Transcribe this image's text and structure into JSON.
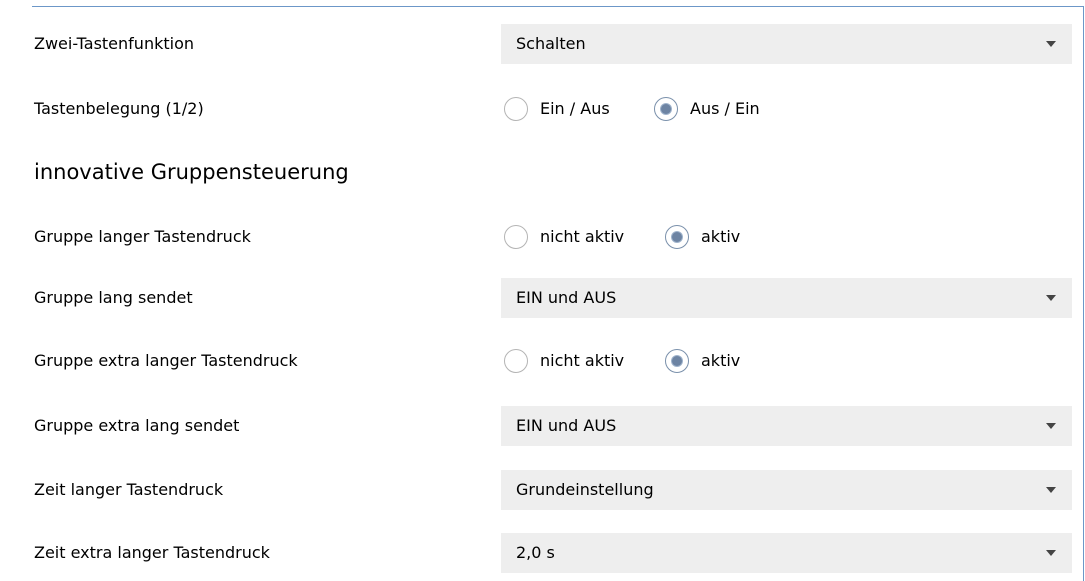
{
  "rows": {
    "zwei_tastenfunktion": {
      "label": "Zwei-Tastenfunktion",
      "value": "Schalten"
    },
    "tastenbelegung": {
      "label": "Tastenbelegung (1/2)",
      "options": [
        "Ein / Aus",
        "Aus / Ein"
      ],
      "selected": "Aus / Ein"
    },
    "section": {
      "title": "innovative Gruppensteuerung"
    },
    "gruppe_langer": {
      "label": "Gruppe langer Tastendruck",
      "options": [
        "nicht aktiv",
        "aktiv"
      ],
      "selected": "aktiv"
    },
    "gruppe_lang_sendet": {
      "label": "Gruppe lang sendet",
      "value": "EIN und AUS"
    },
    "gruppe_extra_langer": {
      "label": "Gruppe extra langer Tastendruck",
      "options": [
        "nicht aktiv",
        "aktiv"
      ],
      "selected": "aktiv"
    },
    "gruppe_extra_lang_sendet": {
      "label": "Gruppe extra lang sendet",
      "value": "EIN und AUS"
    },
    "zeit_langer": {
      "label": "Zeit langer Tastendruck",
      "value": "Grundeinstellung"
    },
    "zeit_extra_langer": {
      "label": "Zeit extra langer Tastendruck",
      "value": "2,0 s"
    }
  },
  "icons": {
    "dropdown": "chevron-down-icon",
    "radio": "radio-button-icon"
  },
  "colors": {
    "frame_border": "#6c97c8",
    "select_bg": "#eeeeee",
    "radio_selected": "#6d84a3"
  }
}
